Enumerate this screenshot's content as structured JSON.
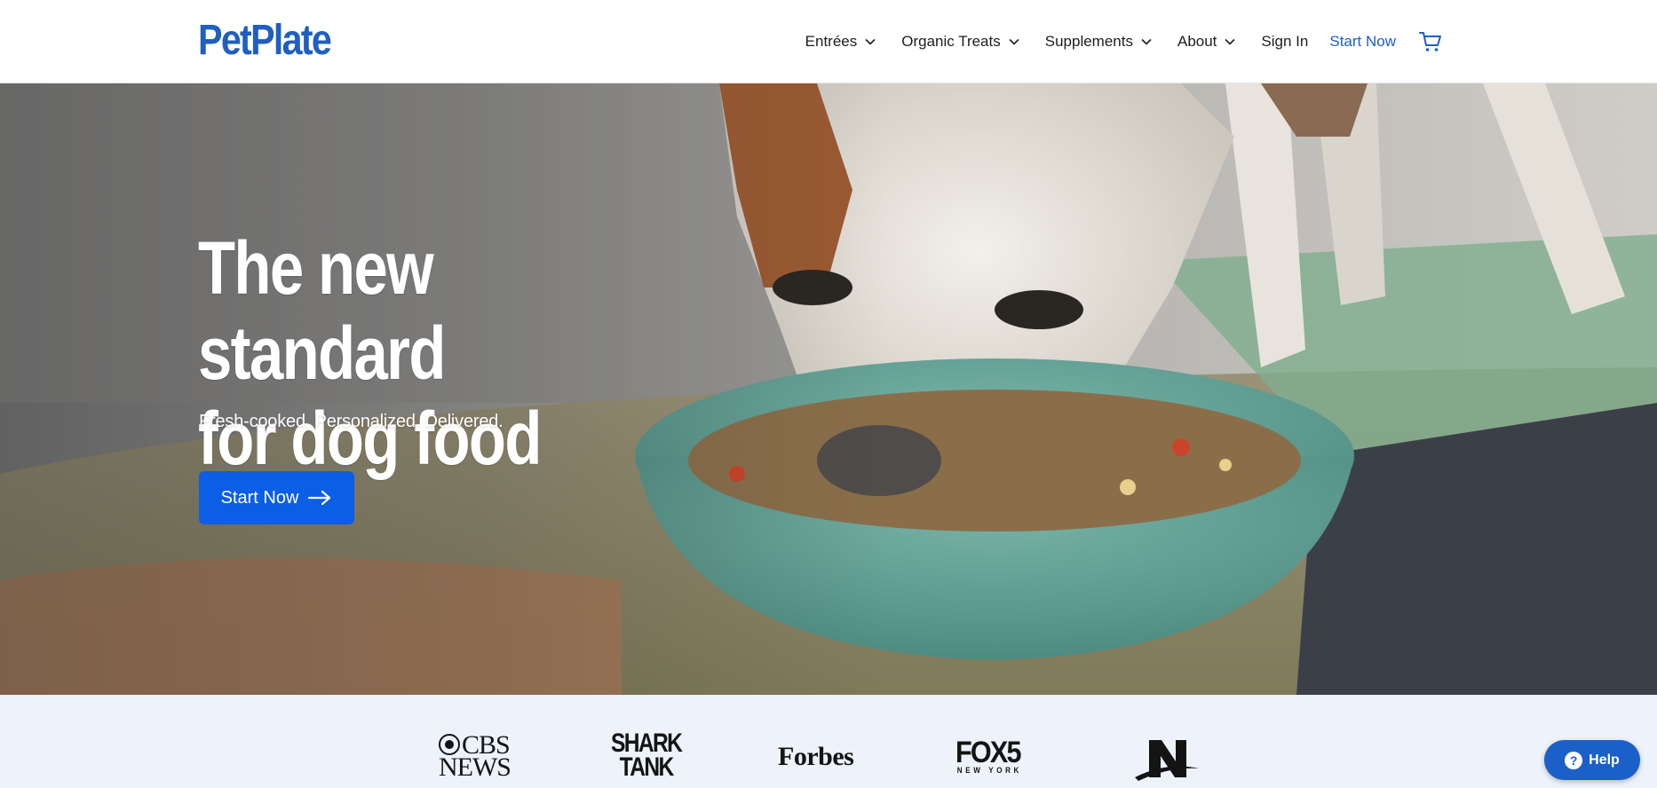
{
  "header": {
    "logo": "PetPlate",
    "nav": [
      {
        "label": "Entrées",
        "icon": "chevron-down-icon"
      },
      {
        "label": "Organic Treats",
        "icon": "chevron-down-icon"
      },
      {
        "label": "Supplements",
        "icon": "chevron-down-icon"
      },
      {
        "label": "About",
        "icon": "chevron-down-icon"
      }
    ],
    "sign_in": "Sign In",
    "start_now": "Start Now",
    "cart_icon": "cart-icon"
  },
  "hero": {
    "title_line1": "The new standard",
    "title_line2": "for dog food",
    "subtitle": "Fresh-cooked. Personalized. Delivered.",
    "cta_label": "Start Now",
    "cta_icon": "arrow-right-icon",
    "image": "dog eating from teal bowl"
  },
  "press": {
    "cbs_line1": "CBS",
    "cbs_line2": "NEWS",
    "shark_line1": "SHARK",
    "shark_line2": "TANK",
    "forbes": "Forbes",
    "fox": "FOX5",
    "fox_sub": "NEW YORK"
  },
  "help": {
    "label": "Help",
    "icon": "help-icon"
  },
  "colors": {
    "brand_blue": "#1f5fbf",
    "cta_blue": "#0b5ee6",
    "press_bg": "#edf2fb",
    "white": "#ffffff"
  }
}
